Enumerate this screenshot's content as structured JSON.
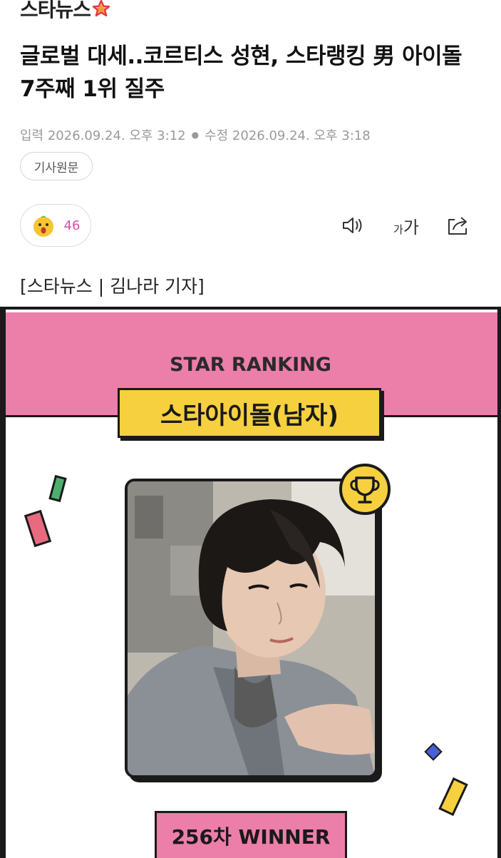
{
  "header": {
    "logo_text": "스타뉴스"
  },
  "article": {
    "headline": "글로벌 대세..코르티스 성현, 스타랭킹 男 아이돌 7주째 1위 질주",
    "published": "입력 2026.09.24. 오후 3:12",
    "modified": "수정 2026.09.24. 오후 3:18",
    "original_button": "기사원문",
    "reaction_count": "46",
    "font_size_label": "가가",
    "byline": "[스타뉴스 | 김나라 기자]"
  },
  "card": {
    "title": "STAR RANKING",
    "category": "스타아이돌(남자)",
    "winner": "256차 WINNER",
    "colors": {
      "pink": "#ec7eaa",
      "yellow": "#f6d03e",
      "green": "#4caf6e",
      "blue": "#4a5fd6"
    }
  },
  "icons": {
    "reaction": "emoji-face-icon",
    "speaker": "speaker-icon",
    "font_size": "font-size-icon",
    "share": "share-icon",
    "trophy": "trophy-icon"
  }
}
